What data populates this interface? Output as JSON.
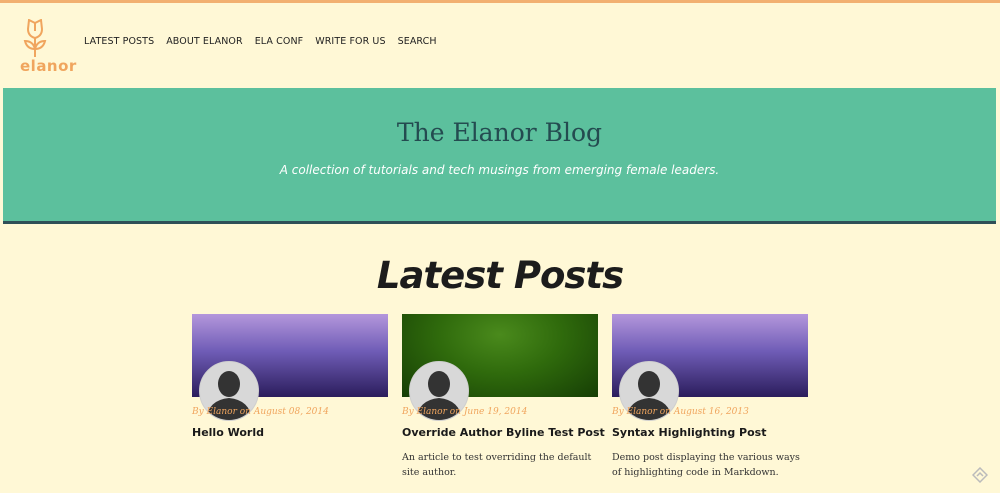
{
  "colors": {
    "background": "#fff8d6",
    "accent_orange": "#f0a55e",
    "hero_green": "#5cc09d",
    "hero_border": "#2f4f57",
    "title_dark": "#244b50"
  },
  "logo": {
    "icon": "tulip-icon",
    "text": "elanor"
  },
  "nav": {
    "items": [
      {
        "label": "LATEST POSTS"
      },
      {
        "label": "ABOUT ELANOR"
      },
      {
        "label": "ELA CONF"
      },
      {
        "label": "WRITE FOR US"
      },
      {
        "label": "SEARCH"
      }
    ]
  },
  "hero": {
    "title": "The Elanor Blog",
    "subtitle": "A collection of tutorials and tech musings from emerging female leaders."
  },
  "section": {
    "title": "Latest Posts"
  },
  "posts": [
    {
      "image": "purple-gradient",
      "byline": "By Elanor on August 08, 2014",
      "title": "Hello World",
      "excerpt": ""
    },
    {
      "image": "green-gradient",
      "byline": "By Elanor on June 19, 2014",
      "title": "Override Author Byline Test Post",
      "excerpt": "An article to test overriding the default site author."
    },
    {
      "image": "purple-gradient",
      "byline": "By Elanor on August 16, 2013",
      "title": "Syntax Highlighting Post",
      "excerpt": "Demo post displaying the various ways of highlighting code in Markdown."
    }
  ],
  "corner": {
    "icon": "scroll-to-top-icon"
  }
}
